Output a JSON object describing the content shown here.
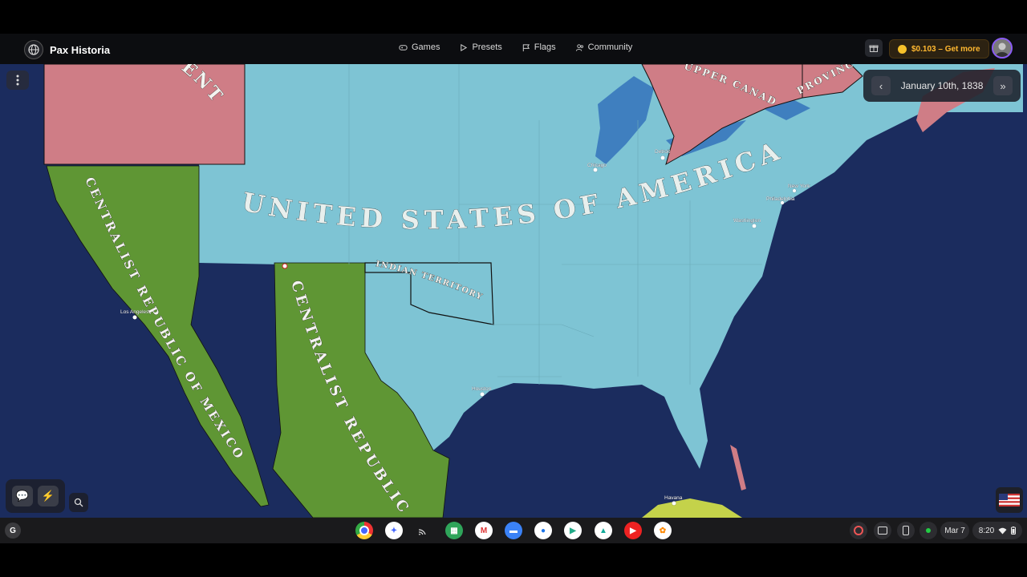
{
  "header": {
    "brand": "Pax Historia",
    "nav": [
      {
        "label": "Games",
        "icon": "gamepad-icon"
      },
      {
        "label": "Presets",
        "icon": "play-icon"
      },
      {
        "label": "Flags",
        "icon": "flag-icon"
      },
      {
        "label": "Community",
        "icon": "users-icon"
      }
    ],
    "credits": "$0.103 – Get more"
  },
  "date_panel": {
    "date": "January 10th, 1838",
    "prev_symbol": "‹",
    "next_symbol": "»"
  },
  "map": {
    "labels": {
      "usa": "UNITED STATES OF AMERICA",
      "indian_territory": "INDIAN TERRITORY",
      "mexico_west": "CENTRALIST REPUBLIC OF MEXICO",
      "mexico_east": "CENTRALIST REPUBLIC",
      "upper_canada": "UPPER CANADA",
      "province": "PROVINCE",
      "nw_partial": "ENT"
    },
    "cities": [
      {
        "name": "Chicago"
      },
      {
        "name": "Detroit"
      },
      {
        "name": "New York"
      },
      {
        "name": "Philadelphia"
      },
      {
        "name": "Washington"
      },
      {
        "name": "Houston"
      },
      {
        "name": "Los Angeles"
      },
      {
        "name": "Havana"
      }
    ],
    "colors": {
      "ocean": "#1b2c5e",
      "usa": "#7ec4d4",
      "mexico": "#5f9634",
      "british": "#cf7d86",
      "cuba": "#c4d24a"
    }
  },
  "shelf": {
    "launcher": "G",
    "date": "Mar 7",
    "time": "8:20"
  }
}
